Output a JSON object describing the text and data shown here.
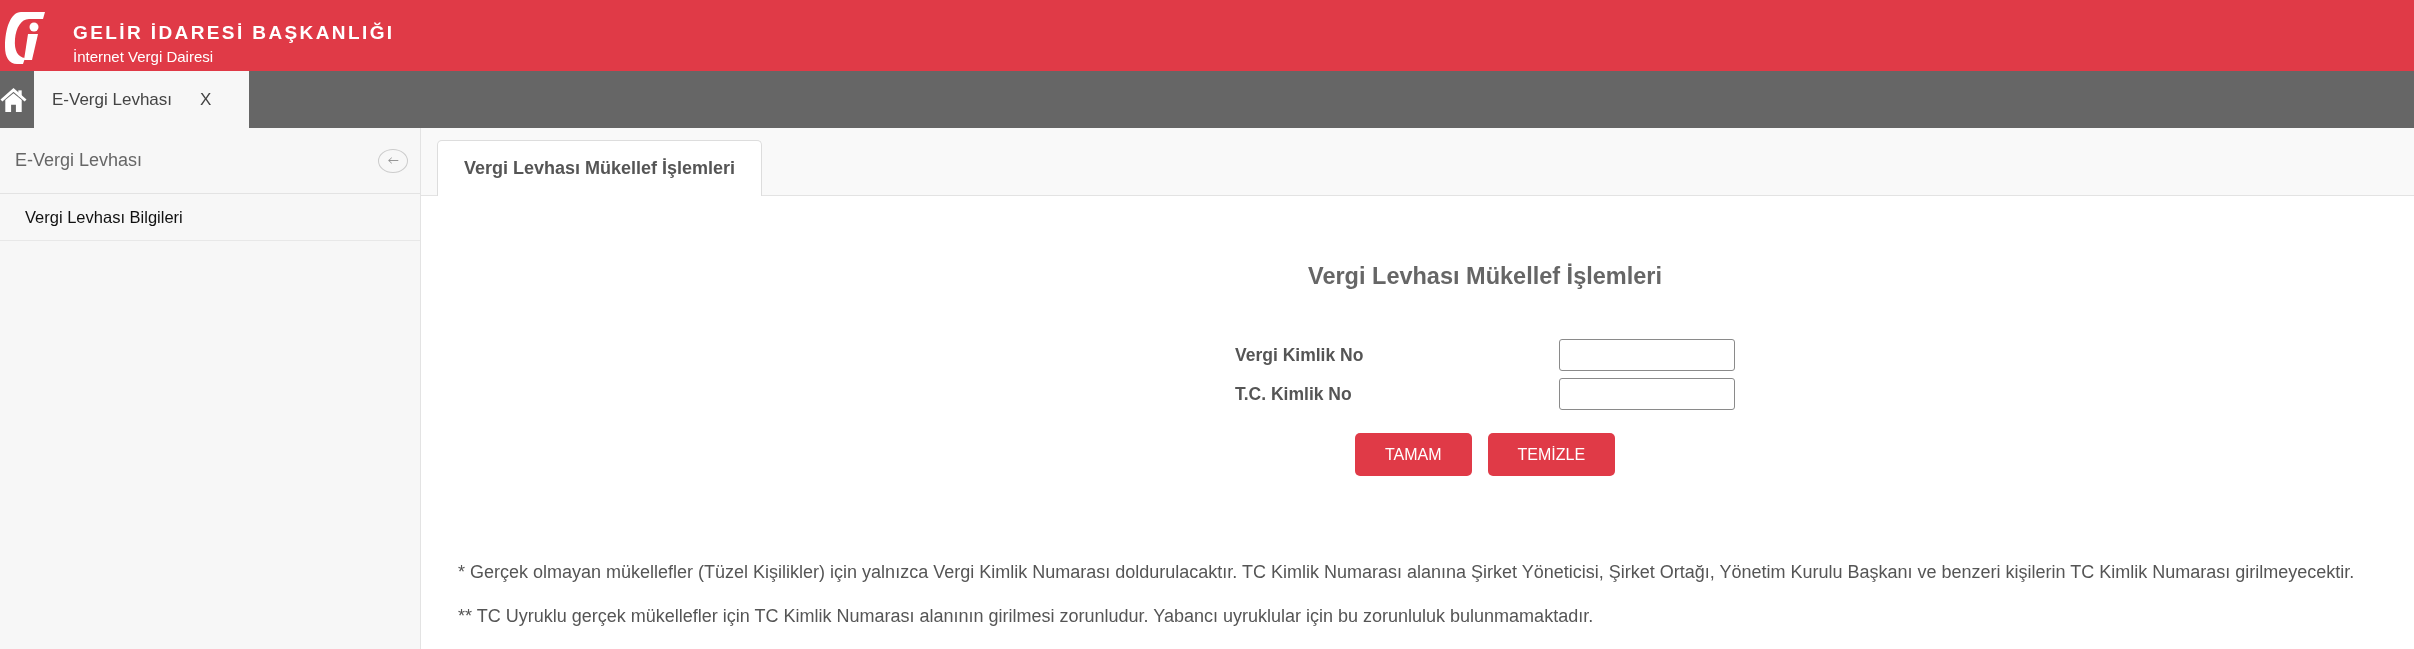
{
  "header": {
    "title": "GELİR İDARESİ BAŞKANLIĞI",
    "subtitle": "İnternet Vergi Dairesi"
  },
  "tabs": [
    {
      "label": "E-Vergi Levhası",
      "close": "X",
      "selected": true
    }
  ],
  "sidebar": {
    "title": "E-Vergi Levhası",
    "items": [
      {
        "label": "Vergi Levhası Bilgileri",
        "selected": false
      }
    ]
  },
  "content_tabs": [
    {
      "label": "Vergi Levhası Mükellef İşlemleri",
      "selected": true
    }
  ],
  "form": {
    "title": "Vergi Levhası Mükellef İşlemleri",
    "fields": [
      {
        "label": "Vergi Kimlik No"
      },
      {
        "label": "T.C. Kimlik No"
      }
    ],
    "buttons": [
      "TAMAM",
      "TEMİZLE"
    ]
  },
  "notes": [
    "* Gerçek olmayan mükellefler (Tüzel Kişilikler) için yalnızca Vergi Kimlik Numarası doldurulacaktır. TC Kimlik Numarası alanına Şirket Yöneticisi, Şirket Ortağı, Yönetim Kurulu Başkanı ve benzeri kişilerin TC Kimlik Numarası girilmeyecektir.",
    "** TC Uyruklu gerçek mükellefler için TC Kimlik Numarası alanının girilmesi zorunludur. Yabancı uyruklular için bu zorunluluk bulunmamaktadır."
  ]
}
